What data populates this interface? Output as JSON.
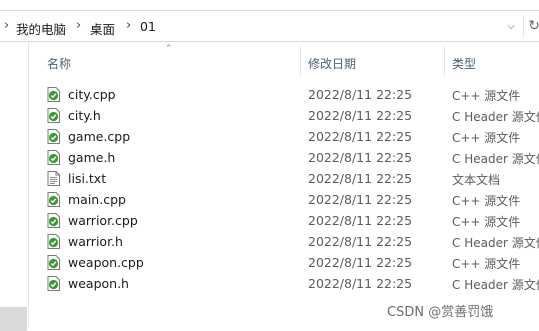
{
  "breadcrumb": {
    "items": [
      {
        "label": "我的电脑"
      },
      {
        "label": "桌面"
      },
      {
        "label": "01"
      }
    ]
  },
  "columns": {
    "name": "名称",
    "modified": "修改日期",
    "type": "类型"
  },
  "files": [
    {
      "name": "city.cpp",
      "modified": "2022/8/11 22:25",
      "type": "C++ 源文件",
      "icon": "cpp-file-icon"
    },
    {
      "name": "city.h",
      "modified": "2022/8/11 22:25",
      "type": "C Header 源文件",
      "icon": "header-file-icon"
    },
    {
      "name": "game.cpp",
      "modified": "2022/8/11 22:25",
      "type": "C++ 源文件",
      "icon": "cpp-file-icon"
    },
    {
      "name": "game.h",
      "modified": "2022/8/11 22:25",
      "type": "C Header 源文件",
      "icon": "header-file-icon"
    },
    {
      "name": "lisi.txt",
      "modified": "2022/8/11 22:25",
      "type": "文本文档",
      "icon": "text-file-icon"
    },
    {
      "name": "main.cpp",
      "modified": "2022/8/11 22:25",
      "type": "C++ 源文件",
      "icon": "cpp-file-icon"
    },
    {
      "name": "warrior.cpp",
      "modified": "2022/8/11 22:25",
      "type": "C++ 源文件",
      "icon": "cpp-file-icon"
    },
    {
      "name": "warrior.h",
      "modified": "2022/8/11 22:25",
      "type": "C Header 源文件",
      "icon": "header-file-icon"
    },
    {
      "name": "weapon.cpp",
      "modified": "2022/8/11 22:25",
      "type": "C++ 源文件",
      "icon": "cpp-file-icon"
    },
    {
      "name": "weapon.h",
      "modified": "2022/8/11 22:25",
      "type": "C Header 源文件",
      "icon": "header-file-icon"
    }
  ],
  "watermark": "CSDN @赏善罚饿",
  "colors": {
    "accent_green": "#3a9a34",
    "header_text": "#4c607a",
    "selection": "#d9d9d9"
  }
}
